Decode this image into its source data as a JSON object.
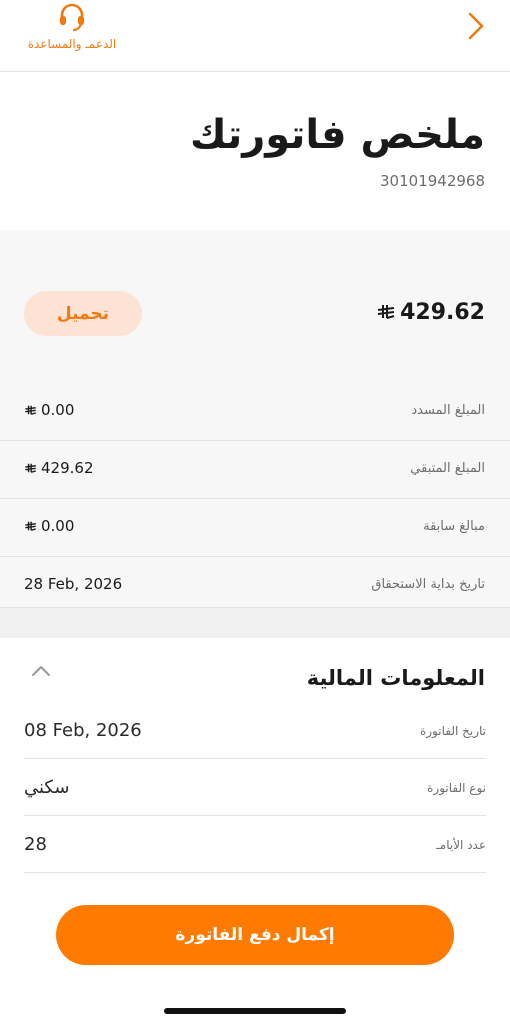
{
  "header": {
    "support_label": "الدعمـ والمساعدة",
    "support_icon": "headset-icon",
    "back_icon": "chevron-right-icon",
    "accent_color": "#f07a10"
  },
  "invoice": {
    "title": "ملخص فاتورتك",
    "number": "30101942968",
    "total": "429.62",
    "currency_icon": "saudi-riyal-icon",
    "download_label": "تحميل"
  },
  "summary_rows": [
    {
      "label": "المبلغ المسدد",
      "value": "0.00",
      "currency": true
    },
    {
      "label": "المبلغ المتبقي",
      "value": "429.62",
      "currency": true
    },
    {
      "label": "مبالغ سابقة",
      "value": "0.00",
      "currency": true
    },
    {
      "label": "تاريخ بداية الاستحقاق",
      "value": "28 Feb, 2026",
      "currency": false
    }
  ],
  "financial": {
    "title": "المعلومات المالية",
    "collapse_icon": "chevron-up-icon",
    "rows": [
      {
        "label": "تاريخ الفاتورة",
        "value": "08 Feb, 2026"
      },
      {
        "label": "نوع الفاتورة",
        "value": "سكني"
      },
      {
        "label": "عدد الأيامـ",
        "value": "28"
      }
    ]
  },
  "pay_button": {
    "label": "إكمال دفع الفاتورة",
    "color": "#ff7a00"
  }
}
